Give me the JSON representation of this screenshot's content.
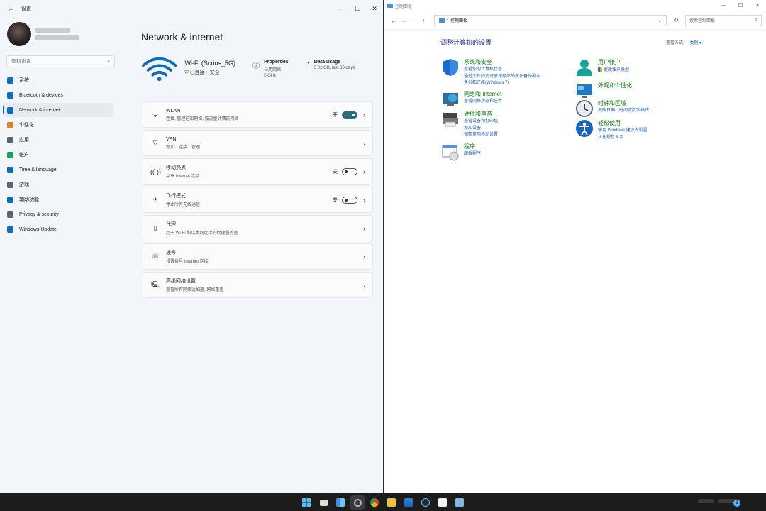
{
  "settings": {
    "window_title": "设置",
    "search_placeholder": "查找设置",
    "nav": [
      {
        "label": "系统",
        "icon": "monitor-icon",
        "color": "#0f6cbd"
      },
      {
        "label": "Bluetooth & devices",
        "icon": "bluetooth-icon",
        "color": "#0f6cbd"
      },
      {
        "label": "Network & internet",
        "icon": "wifi-icon",
        "color": "#0f6cbd",
        "active": true
      },
      {
        "label": "个性化",
        "icon": "brush-icon",
        "color": "#d9822b"
      },
      {
        "label": "应用",
        "icon": "apps-icon",
        "color": "#5b6470"
      },
      {
        "label": "帐户",
        "icon": "person-icon",
        "color": "#1aa260"
      },
      {
        "label": "Time & language",
        "icon": "globe-clock-icon",
        "color": "#0f6cbd"
      },
      {
        "label": "游戏",
        "icon": "gamepad-icon",
        "color": "#5b6470"
      },
      {
        "label": "辅助功能",
        "icon": "accessibility-icon",
        "color": "#0f6cbd"
      },
      {
        "label": "Privacy & security",
        "icon": "shield-icon",
        "color": "#5b6470"
      },
      {
        "label": "Windows Update",
        "icon": "update-icon",
        "color": "#0f6cbd"
      }
    ],
    "page_title": "Network & internet",
    "hero": {
      "ssid": "Wi-Fi (Scrius_5G)",
      "status": "已连接，安全",
      "properties_title": "Properties",
      "properties_sub1": "公用网络",
      "properties_sub2": "5 GHz",
      "usage_title": "Data usage",
      "usage_sub": "5.02 GB, last 30 days"
    },
    "cards": [
      {
        "title": "WLAN",
        "sub": "连接, 管理已知网络, 按流量计费的网络",
        "state": "开",
        "toggle": "on",
        "icon": "wifi-icon"
      },
      {
        "title": "VPN",
        "sub": "添加、连接、管理",
        "state": "",
        "toggle": "none",
        "icon": "vpn-shield-icon"
      },
      {
        "title": "移动热点",
        "sub": "共享 Internet 连接",
        "state": "关",
        "toggle": "off",
        "icon": "hotspot-icon"
      },
      {
        "title": "飞行模式",
        "sub": "停止所有无线通信",
        "state": "关",
        "toggle": "off",
        "icon": "airplane-icon"
      },
      {
        "title": "代理",
        "sub": "用于 Wi-Fi 和以太网连接的代理服务器",
        "state": "",
        "toggle": "none",
        "icon": "proxy-icon"
      },
      {
        "title": "拨号",
        "sub": "设置拨号 Internet 连接",
        "state": "",
        "toggle": "none",
        "icon": "dialup-icon"
      },
      {
        "title": "高级网络设置",
        "sub": "查看所有网络适配器, 网络重置",
        "state": "",
        "toggle": "none",
        "icon": "network-monitor-icon"
      }
    ]
  },
  "cpanel": {
    "window_title": "控制面板",
    "address": "控制面板",
    "search_placeholder": "搜索控制面板",
    "heading": "调整计算机的设置",
    "view_by_label": "查看方式:",
    "view_by_value": "类别 ▾",
    "left_categories": [
      {
        "title": "系统和安全",
        "links": [
          "查看你的计算机状态",
          "通过文件历史记录保存你的文件备份副本",
          "备份和还原(Windows 7)"
        ],
        "icon": "security-shield-icon"
      },
      {
        "title": "网络和 Internet",
        "links": [
          "查看网络状态和任务"
        ],
        "icon": "network-globe-icon"
      },
      {
        "title": "硬件和声音",
        "links": [
          "查看设备和打印机",
          "添加设备",
          "调整常用移动设置"
        ],
        "icon": "printer-icon"
      },
      {
        "title": "程序",
        "links": [
          "卸载程序"
        ],
        "icon": "programs-icon"
      }
    ],
    "right_categories": [
      {
        "title": "用户帐户",
        "links": [
          "更改帐户类型"
        ],
        "icon": "user-accounts-icon"
      },
      {
        "title": "外观和个性化",
        "links": [],
        "icon": "appearance-icon"
      },
      {
        "title": "时钟和区域",
        "links": [
          "更改日期、时间或数字格式"
        ],
        "icon": "clock-region-icon"
      },
      {
        "title": "轻松使用",
        "links": [
          "使用 Windows 建议的设置",
          "优化视觉显示"
        ],
        "icon": "ease-of-access-icon"
      }
    ]
  },
  "taskbar": {
    "notification_count": "1"
  }
}
